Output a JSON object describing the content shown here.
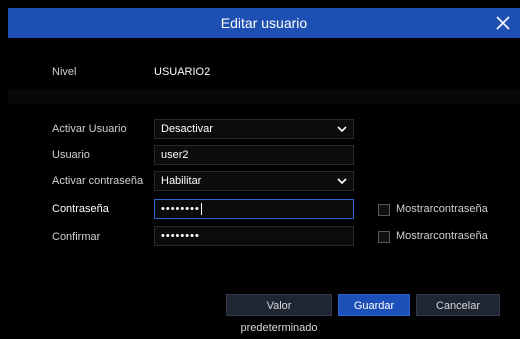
{
  "dialog": {
    "title": "Editar usuario"
  },
  "form": {
    "level_label": "Nivel",
    "level_value": "USUARIO2",
    "activate_user_label": "Activar Usuario",
    "activate_user_value": "Desactivar",
    "username_label": "Usuario",
    "username_value": "user2",
    "activate_password_label": "Activar contraseña",
    "activate_password_value": "Habilitar",
    "password_label": "Contraseña",
    "password_mask": "••••••••",
    "confirm_label": "Confirmar",
    "confirm_mask": "••••••••",
    "show_password_label": "Mostrarcontraseña",
    "show_confirm_label": "Mostrarcontraseña"
  },
  "buttons": {
    "default_label": "Valor predeterminado",
    "save_label": "Guardar",
    "cancel_label": "Cancelar"
  },
  "colors": {
    "accent": "#1e4fb3",
    "background": "#000000"
  }
}
